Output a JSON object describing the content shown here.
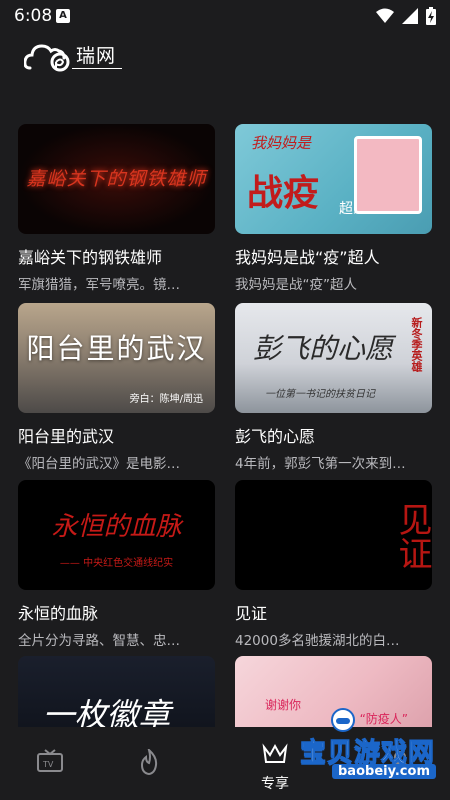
{
  "status_bar": {
    "time": "6:08",
    "notif_icon_letter": "A"
  },
  "app": {
    "logo_text": "瑞网"
  },
  "cards": [
    {
      "title": "嘉峪关下的钢铁雄师",
      "desc": "军旗猎猎，军号嘹亮。镜…",
      "thumb_caption": "嘉峪关下的钢铁雄师"
    },
    {
      "title": "我妈妈是战“疫”超人",
      "desc": "我妈妈是战“疫”超人",
      "thumb_caption_top": "我妈妈是",
      "thumb_caption_main": "战疫",
      "thumb_caption_small": "超人"
    },
    {
      "title": "阳台里的武汉",
      "desc": "《阳台里的武汉》是电影…",
      "thumb_caption": "阳台里的武汉",
      "thumb_sub": "旁白：陈坤/周迅"
    },
    {
      "title": "彭飞的心愿",
      "desc": "4年前，郭彭飞第一次来到…",
      "thumb_caption": "彭飞的心愿",
      "thumb_stamp": "新冬季英雄",
      "thumb_sub": "一位第一书记的扶贫日记"
    },
    {
      "title": "永恒的血脉",
      "desc": "全片分为寻路、智慧、忠…",
      "thumb_caption": "永恒的血脉",
      "thumb_sub": "—— 中央红色交通线纪实"
    },
    {
      "title": "见证",
      "desc": "42000多名驰援湖北的白…",
      "thumb_caption": "见证"
    },
    {
      "title": "",
      "desc": "",
      "thumb_caption": "一枚徽章"
    },
    {
      "title": "",
      "desc": "",
      "thumb_caption": "谢谢你",
      "thumb_caption_2": "“防疫人”"
    }
  ],
  "tabbar": {
    "tabs": [
      {
        "icon": "tv-icon",
        "label": ""
      },
      {
        "icon": "flame-icon",
        "label": ""
      },
      {
        "icon": "crown-icon",
        "label": "专享"
      },
      {
        "icon": "profile-icon",
        "label": ""
      }
    ]
  },
  "watermark": {
    "main": "宝贝游戏网",
    "url": "baobeiy.com"
  },
  "colors": {
    "background": "#1c1c1e",
    "desc_text": "#b9b9bd",
    "watermark_blue": "#1b66c9"
  }
}
